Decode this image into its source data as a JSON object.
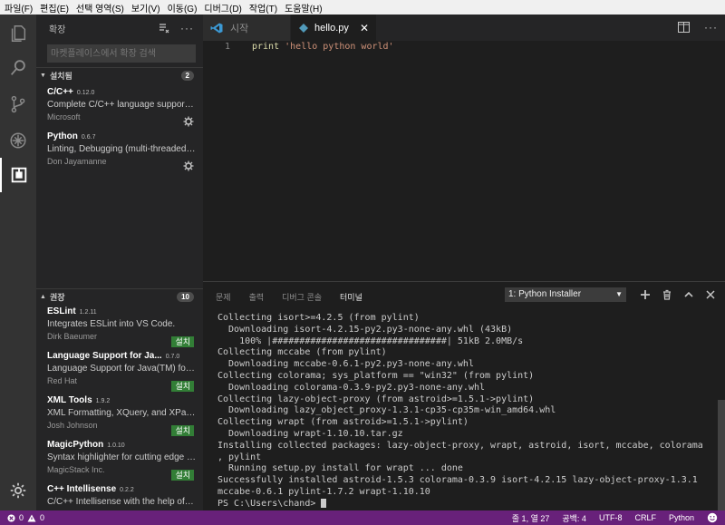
{
  "menubar": {
    "items": [
      "파일(F)",
      "편집(E)",
      "선택 영역(S)",
      "보기(V)",
      "이동(G)",
      "디버그(D)",
      "작업(T)",
      "도움말(H)"
    ]
  },
  "sidebar": {
    "title": "확장",
    "search_placeholder": "마켓플레이스에서 확장 검색",
    "installed": {
      "label": "설치됨",
      "count": "2",
      "items": [
        {
          "name": "C/C++",
          "version": "0.12.0",
          "desc": "Complete C/C++ language support including code...",
          "publisher": "Microsoft"
        },
        {
          "name": "Python",
          "version": "0.6.7",
          "desc": "Linting, Debugging (multi-threaded, remote), Intellisense...",
          "publisher": "Don Jayamanne"
        }
      ]
    },
    "recommended": {
      "label": "권장",
      "count": "10",
      "install_label": "설치",
      "items": [
        {
          "name": "ESLint",
          "version": "1.2.11",
          "desc": "Integrates ESLint into VS Code.",
          "publisher": "Dirk Baeumer"
        },
        {
          "name": "Language Support for Ja...",
          "version": "0.7.0",
          "desc": "Language Support for Java(TM) for Visual Studio Code",
          "publisher": "Red Hat"
        },
        {
          "name": "XML Tools",
          "version": "1.9.2",
          "desc": "XML Formatting, XQuery, and XPath Tools for VS Code",
          "publisher": "Josh Johnson"
        },
        {
          "name": "MagicPython",
          "version": "1.0.10",
          "desc": "Syntax highlighter for cutting edge Python",
          "publisher": "MagicStack Inc."
        },
        {
          "name": "C++ Intellisense",
          "version": "0.2.2",
          "desc": "C/C++ Intellisense with the help of GNU Global",
          "publisher": ""
        }
      ]
    }
  },
  "tabs": [
    {
      "label": "시작",
      "active": false
    },
    {
      "label": "hello.py",
      "active": true
    }
  ],
  "editor": {
    "lines": [
      {
        "no": "1",
        "keyword": "print",
        "string": "'hello python world'"
      }
    ]
  },
  "panel": {
    "tabs": [
      "문제",
      "출력",
      "디버그 콘솔",
      "터미널"
    ],
    "active_tab": "터미널",
    "terminal_select": "1: Python Installer",
    "terminal_lines": [
      "Collecting isort>=4.2.5 (from pylint)",
      "  Downloading isort-4.2.15-py2.py3-none-any.whl (43kB)",
      "    100% |################################| 51kB 2.0MB/s",
      "Collecting mccabe (from pylint)",
      "  Downloading mccabe-0.6.1-py2.py3-none-any.whl",
      "Collecting colorama; sys_platform == \"win32\" (from pylint)",
      "  Downloading colorama-0.3.9-py2.py3-none-any.whl",
      "Collecting lazy-object-proxy (from astroid>=1.5.1->pylint)",
      "  Downloading lazy_object_proxy-1.3.1-cp35-cp35m-win_amd64.whl",
      "Collecting wrapt (from astroid>=1.5.1->pylint)",
      "  Downloading wrapt-1.10.10.tar.gz",
      "Installing collected packages: lazy-object-proxy, wrapt, astroid, isort, mccabe, colorama",
      ", pylint",
      "  Running setup.py install for wrapt ... done",
      "Successfully installed astroid-1.5.3 colorama-0.3.9 isort-4.2.15 lazy-object-proxy-1.3.1",
      "mccabe-0.6.1 pylint-1.7.2 wrapt-1.10.10"
    ],
    "prompt": "PS C:\\Users\\chand> "
  },
  "statusbar": {
    "errors": "0",
    "warnings": "0",
    "position": "줄 1, 열 27",
    "spaces": "공백: 4",
    "encoding": "UTF-8",
    "eol": "CRLF",
    "language": "Python"
  },
  "colors": {
    "statusbar": "#68217a",
    "activitybar": "#333333",
    "sidebar": "#252526",
    "editor": "#1e1e1e",
    "install_button": "#327e36"
  }
}
